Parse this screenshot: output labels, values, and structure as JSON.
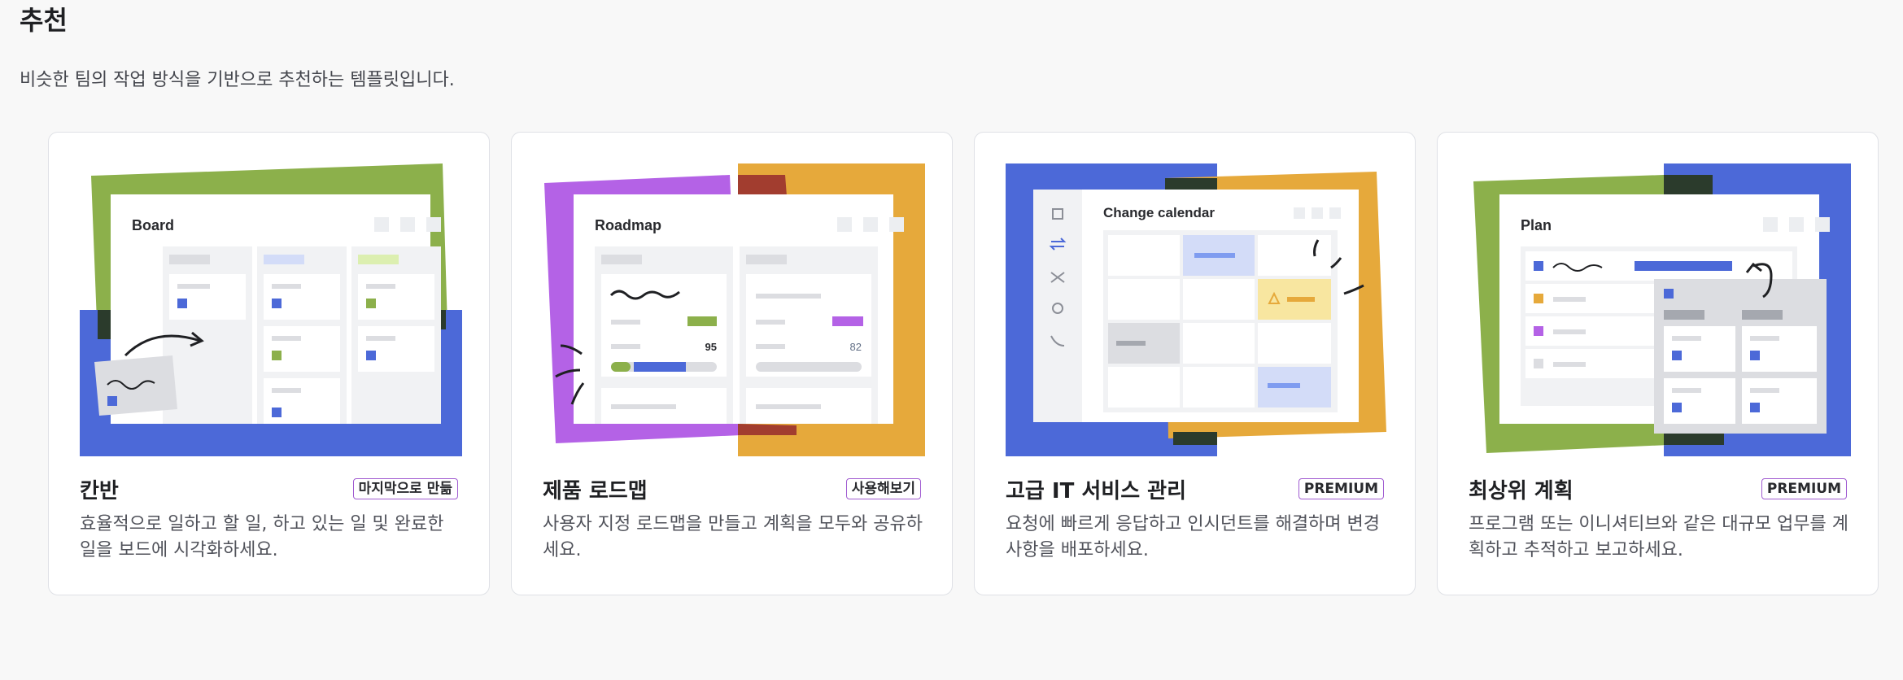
{
  "section": {
    "title": "추천",
    "description": "비슷한 팀의 작업 방식을 기반으로 추천하는 템플릿입니다."
  },
  "colors": {
    "green": "#8cb04b",
    "blue": "#4c69d8",
    "purple": "#b462e6",
    "orange": "#e6a93b",
    "badge_border": "#a05bd1"
  },
  "cards": [
    {
      "title": "칸반",
      "badge": "마지막으로 만듦",
      "description": "효율적으로 일하고 할 일, 하고 있는 일 및 완료한 일을 보드에 시각화하세요.",
      "preview": {
        "label": "Board"
      }
    },
    {
      "title": "제품 로드맵",
      "badge": "사용해보기",
      "description": "사용자 지정 로드맵을 만들고 계획을 모두와 공유하세요.",
      "preview": {
        "label": "Roadmap",
        "value_a": "95",
        "value_b": "82"
      }
    },
    {
      "title": "고급 IT 서비스 관리",
      "badge": "PREMIUM",
      "description": "요청에 빠르게 응답하고 인시던트를 해결하며 변경 사항을 배포하세요.",
      "preview": {
        "label": "Change calendar"
      }
    },
    {
      "title": "최상위 계획",
      "badge": "PREMIUM",
      "description": "프로그램 또는 이니셔티브와 같은 대규모 업무를 계획하고 추적하고 보고하세요.",
      "preview": {
        "label": "Plan"
      }
    }
  ]
}
